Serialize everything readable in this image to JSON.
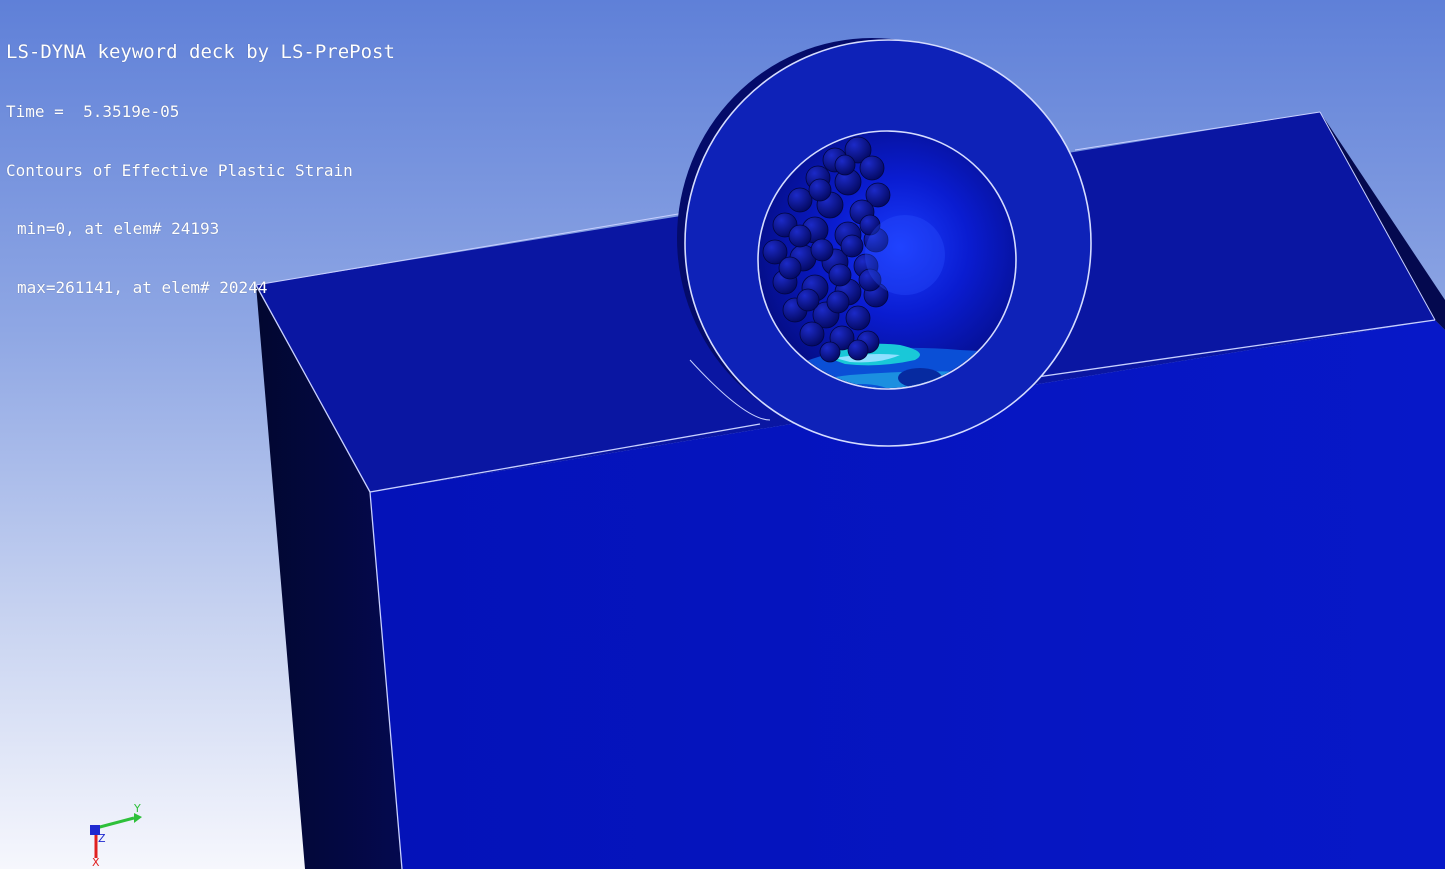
{
  "hud": {
    "title": "LS-DYNA keyword deck by LS-PrePost",
    "time_line": "Time =  5.3519e-05",
    "contour_line": "Contours of Effective Plastic Strain",
    "min_line": "min=0, at elem# 24193",
    "max_line": "max=261141, at elem# 20244"
  },
  "triad": {
    "y_label": "Y",
    "z_label": "Z",
    "x_label": "X"
  },
  "colors": {
    "background_top": "#5f80d8",
    "background_bottom": "#f6f7fd",
    "block_front": "#0414c0",
    "block_top": "#0a17a4",
    "block_side": "#03084a",
    "ring": "#0e22b8",
    "strain_cyan": "#19c8d8",
    "strain_green": "#3ddc4a"
  }
}
